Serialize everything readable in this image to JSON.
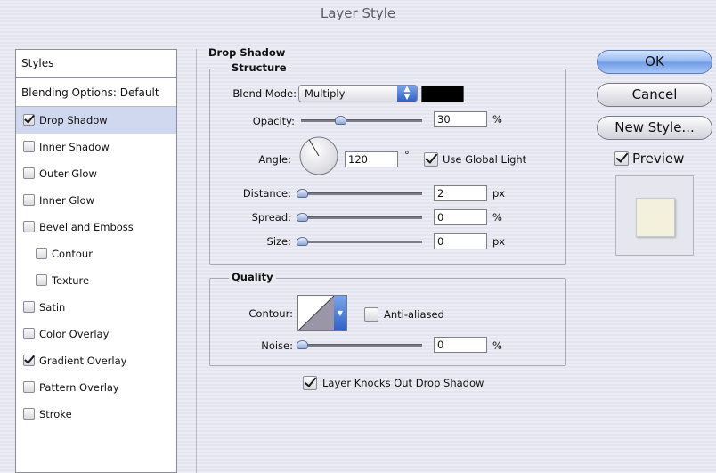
{
  "window": {
    "title": "Layer Style"
  },
  "sidebar": {
    "header": "Styles",
    "blending": "Blending Options: Default",
    "items": [
      {
        "label": "Drop Shadow",
        "checked": true,
        "selected": true,
        "indent": false
      },
      {
        "label": "Inner Shadow",
        "checked": false,
        "selected": false,
        "indent": false
      },
      {
        "label": "Outer Glow",
        "checked": false,
        "selected": false,
        "indent": false
      },
      {
        "label": "Inner Glow",
        "checked": false,
        "selected": false,
        "indent": false
      },
      {
        "label": "Bevel and Emboss",
        "checked": false,
        "selected": false,
        "indent": false
      },
      {
        "label": "Contour",
        "checked": false,
        "selected": false,
        "indent": true
      },
      {
        "label": "Texture",
        "checked": false,
        "selected": false,
        "indent": true
      },
      {
        "label": "Satin",
        "checked": false,
        "selected": false,
        "indent": false
      },
      {
        "label": "Color Overlay",
        "checked": false,
        "selected": false,
        "indent": false
      },
      {
        "label": "Gradient Overlay",
        "checked": true,
        "selected": false,
        "indent": false
      },
      {
        "label": "Pattern Overlay",
        "checked": false,
        "selected": false,
        "indent": false
      },
      {
        "label": "Stroke",
        "checked": false,
        "selected": false,
        "indent": false
      }
    ]
  },
  "drop_shadow": {
    "title": "Drop Shadow",
    "structure": {
      "title": "Structure",
      "blend_mode_label": "Blend Mode:",
      "blend_mode_value": "Multiply",
      "shadow_color": "#000000",
      "opacity_label": "Opacity:",
      "opacity_value": "30",
      "opacity_unit": "%",
      "opacity_fraction": 0.3,
      "angle_label": "Angle:",
      "angle_value": "120",
      "angle_unit": "°",
      "use_global_light_label": "Use Global Light",
      "use_global_light": true,
      "distance_label": "Distance:",
      "distance_value": "2",
      "distance_unit": "px",
      "distance_fraction": 0.0,
      "spread_label": "Spread:",
      "spread_value": "0",
      "spread_unit": "%",
      "spread_fraction": 0.0,
      "size_label": "Size:",
      "size_value": "0",
      "size_unit": "px",
      "size_fraction": 0.0
    },
    "quality": {
      "title": "Quality",
      "contour_label": "Contour:",
      "anti_aliased_label": "Anti-aliased",
      "anti_aliased": false,
      "noise_label": "Noise:",
      "noise_value": "0",
      "noise_unit": "%",
      "noise_fraction": 0.0
    },
    "knocks_out_label": "Layer Knocks Out Drop Shadow",
    "knocks_out": true
  },
  "buttons": {
    "ok": "OK",
    "cancel": "Cancel",
    "new_style": "New Style...",
    "preview_label": "Preview",
    "preview_checked": true
  },
  "colors": {
    "selection": "#cfd8ef",
    "preview_swatch": "#f3f0dc"
  }
}
